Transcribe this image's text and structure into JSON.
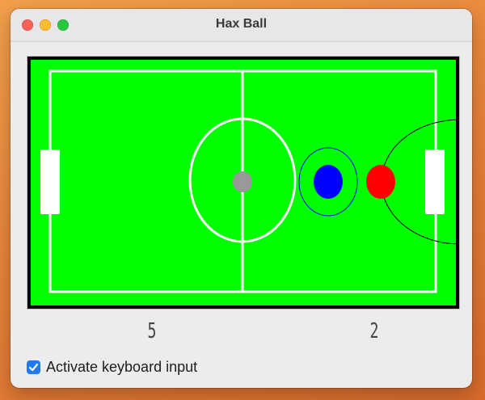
{
  "window": {
    "title": "Hax Ball",
    "traffic_lights": [
      {
        "name": "close",
        "color": "#fe5f57"
      },
      {
        "name": "minimize",
        "color": "#febc2e"
      },
      {
        "name": "maximize",
        "color": "#28c840"
      }
    ]
  },
  "field": {
    "grass_color": "#00ff00",
    "border_color": "#000000",
    "line_color": "#ffffff"
  },
  "players": {
    "ball_color": "#999999",
    "blue_color": "#0000ff",
    "red_color": "#ff0000"
  },
  "scores": {
    "left": "5",
    "right": "2"
  },
  "keyboard": {
    "label": "Activate keyboard input",
    "checked": true,
    "accent": "#1f7cf0"
  }
}
